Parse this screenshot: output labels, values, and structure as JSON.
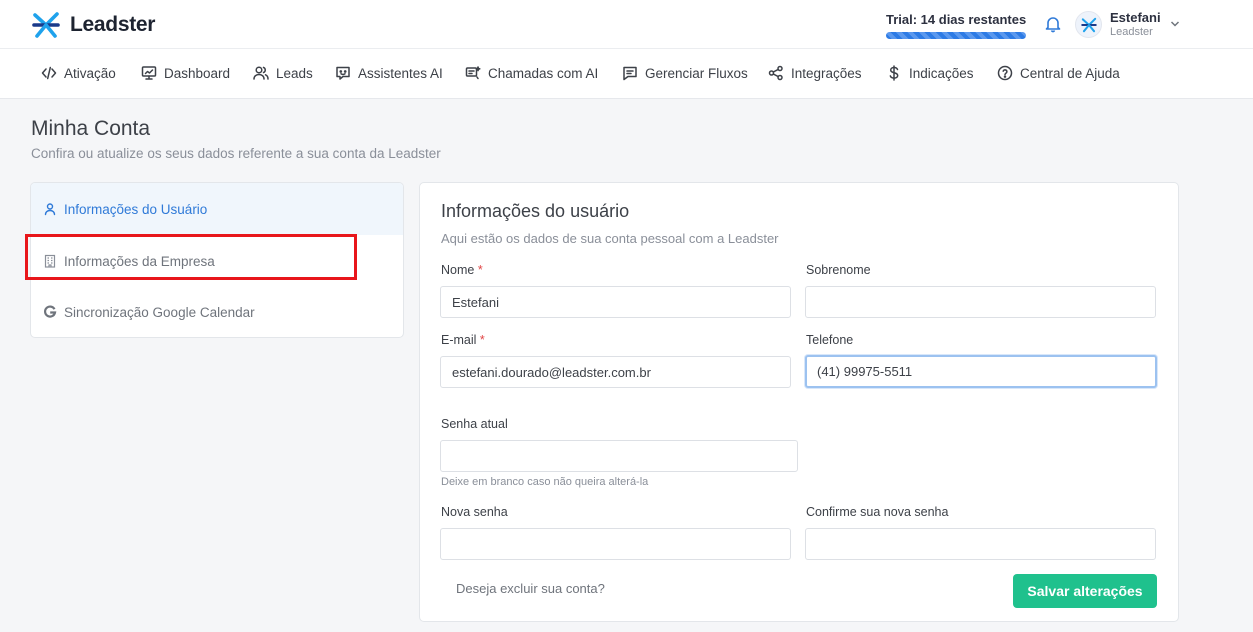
{
  "header": {
    "brand": "Leadster",
    "trial_text": "Trial: 14 dias restantes",
    "user_name": "Estefani",
    "user_org": "Leadster"
  },
  "nav": {
    "items": [
      {
        "label": "Ativação",
        "icon": "code-icon"
      },
      {
        "label": "Dashboard",
        "icon": "monitor-icon"
      },
      {
        "label": "Leads",
        "icon": "users-icon"
      },
      {
        "label": "Assistentes AI",
        "icon": "chat-bot-icon"
      },
      {
        "label": "Chamadas com AI",
        "icon": "ai-call-icon"
      },
      {
        "label": "Gerenciar Fluxos",
        "icon": "message-square-icon"
      },
      {
        "label": "Integrações",
        "icon": "share-nodes-icon"
      },
      {
        "label": "Indicações",
        "icon": "dollar-icon"
      },
      {
        "label": "Central de Ajuda",
        "icon": "help-circle-icon"
      }
    ]
  },
  "page": {
    "title": "Minha Conta",
    "subtitle": "Confira ou atualize os seus dados referente a sua conta da Leadster"
  },
  "side_menu": {
    "items": [
      {
        "label": "Informações do Usuário",
        "icon": "user-icon",
        "active": true
      },
      {
        "label": "Informações da Empresa",
        "icon": "building-icon",
        "active": false
      },
      {
        "label": "Sincronização Google Calendar",
        "icon": "google-icon",
        "active": false
      }
    ]
  },
  "form": {
    "title": "Informações do usuário",
    "subtitle": "Aqui estão os dados de sua conta pessoal com a Leadster",
    "required_mark": "*",
    "fields": {
      "nome": {
        "label": "Nome",
        "value": "Estefani"
      },
      "sobrenome": {
        "label": "Sobrenome",
        "value": ""
      },
      "email": {
        "label": "E-mail",
        "value": "estefani.dourado@leadster.com.br"
      },
      "telefone": {
        "label": "Telefone",
        "value": "(41) 99975-5511"
      },
      "senha_atual": {
        "label": "Senha atual",
        "value": "",
        "hint": "Deixe em branco caso não queira alterá-la"
      },
      "nova_senha": {
        "label": "Nova senha",
        "value": ""
      },
      "confirme_senha": {
        "label": "Confirme sua nova senha",
        "value": ""
      }
    },
    "delete_link": "Deseja excluir sua conta?",
    "save_label": "Salvar alterações"
  },
  "colors": {
    "accent_blue": "#2f7ad8",
    "save_green": "#1fc18d",
    "highlight_red": "#e8161b"
  }
}
